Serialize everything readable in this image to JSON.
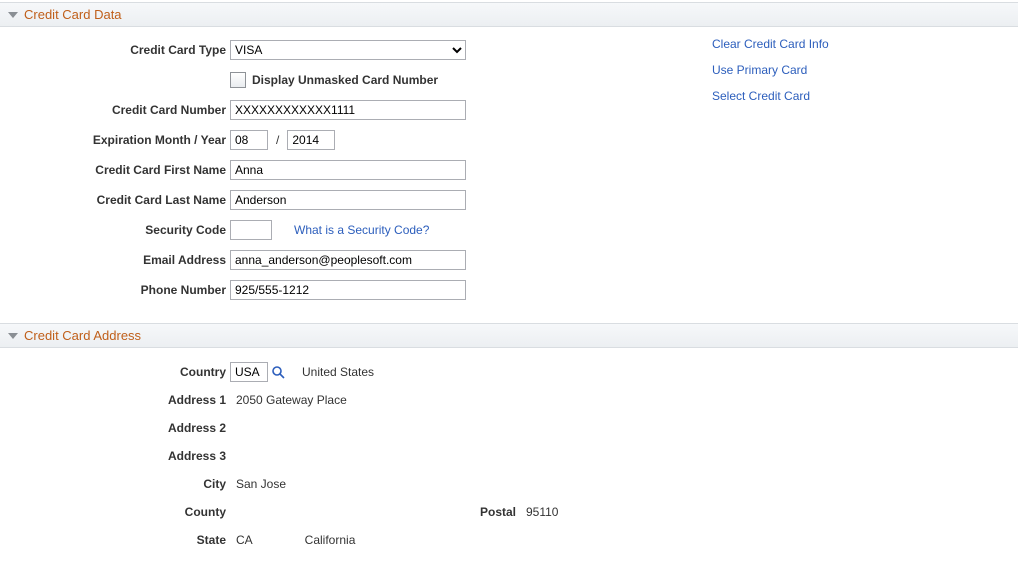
{
  "sections": {
    "ccdata": {
      "title": "Credit Card Data",
      "labels": {
        "cctype": "Credit Card Type",
        "display_unmasked": "Display Unmasked Card Number",
        "ccnumber": "Credit Card Number",
        "exp": "Expiration Month / Year",
        "firstname": "Credit Card First Name",
        "lastname": "Credit Card Last Name",
        "seccode": "Security Code",
        "seccode_link": "What is a Security Code?",
        "email": "Email Address",
        "phone": "Phone Number"
      },
      "values": {
        "cctype": "VISA",
        "ccnumber": "XXXXXXXXXXXX1111",
        "exp_month": "08",
        "exp_year": "2014",
        "firstname": "Anna",
        "lastname": "Anderson",
        "seccode": "",
        "email": "anna_anderson@peoplesoft.com",
        "phone": "925/555-1212"
      },
      "links": {
        "clear": "Clear Credit Card Info",
        "primary": "Use Primary Card",
        "select": "Select Credit Card"
      }
    },
    "ccaddr": {
      "title": "Credit Card Address",
      "labels": {
        "country": "Country",
        "addr1": "Address 1",
        "addr2": "Address 2",
        "addr3": "Address 3",
        "city": "City",
        "county": "County",
        "postal": "Postal",
        "state": "State"
      },
      "values": {
        "country_code": "USA",
        "country_name": "United States",
        "addr1": "2050 Gateway Place",
        "addr2": "",
        "addr3": "",
        "city": "San Jose",
        "county": "",
        "postal": "95110",
        "state_code": "CA",
        "state_name": "California"
      }
    }
  }
}
